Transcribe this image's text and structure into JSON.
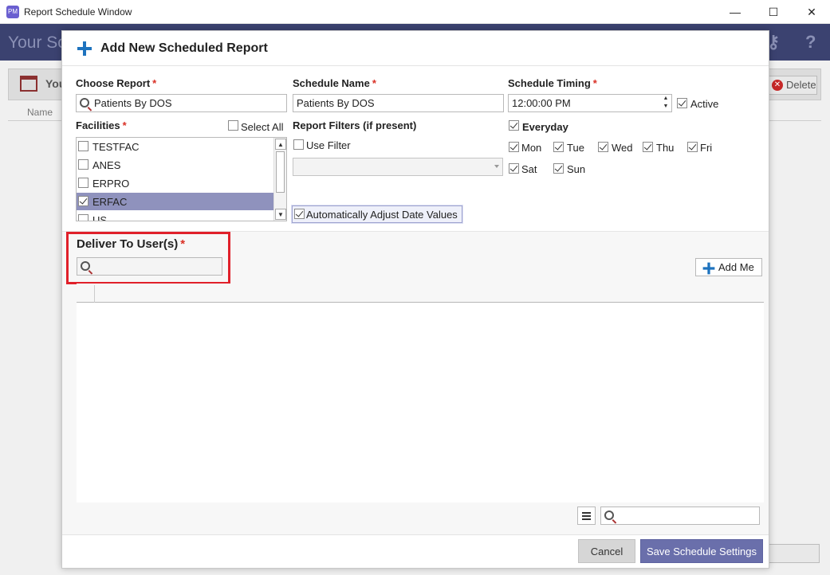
{
  "window": {
    "title": "Report Schedule Window",
    "min": "—",
    "max": "☐",
    "close": "✕",
    "app_icon_text": "PM"
  },
  "background": {
    "header_title": "Your Sc",
    "section_title": "You",
    "column_name": "Name",
    "delete_label": "Delete"
  },
  "modal": {
    "title": "Add New Scheduled Report",
    "choose_report": {
      "label": "Choose Report",
      "value": "Patients By DOS"
    },
    "schedule_name": {
      "label": "Schedule Name",
      "value": "Patients By DOS"
    },
    "schedule_timing": {
      "label": "Schedule Timing",
      "value": "12:00:00 PM",
      "active_label": "Active"
    },
    "facilities": {
      "label": "Facilities",
      "select_all": "Select All",
      "items": [
        {
          "name": "TESTFAC",
          "checked": false
        },
        {
          "name": "ANES",
          "checked": false
        },
        {
          "name": "ERPRO",
          "checked": false
        },
        {
          "name": "ERFAC",
          "checked": true
        },
        {
          "name": "US",
          "checked": false
        }
      ]
    },
    "filters": {
      "label": "Report Filters (if present)",
      "use_filter": "Use Filter",
      "adjust_dates": "Automatically Adjust Date Values"
    },
    "days": {
      "everyday": "Everyday",
      "mon": "Mon",
      "tue": "Tue",
      "wed": "Wed",
      "thu": "Thu",
      "fri": "Fri",
      "sat": "Sat",
      "sun": "Sun"
    },
    "deliver": {
      "label": "Deliver To User(s)",
      "add_me": "Add Me"
    },
    "footer": {
      "cancel": "Cancel",
      "save": "Save Schedule Settings"
    },
    "required_mark": "*"
  },
  "colors": {
    "accent": "#1e73be",
    "header_bg": "#3b4270",
    "selection": "#8f92bd",
    "highlight_border": "#e0202a",
    "save_bg": "#6a6fab"
  }
}
